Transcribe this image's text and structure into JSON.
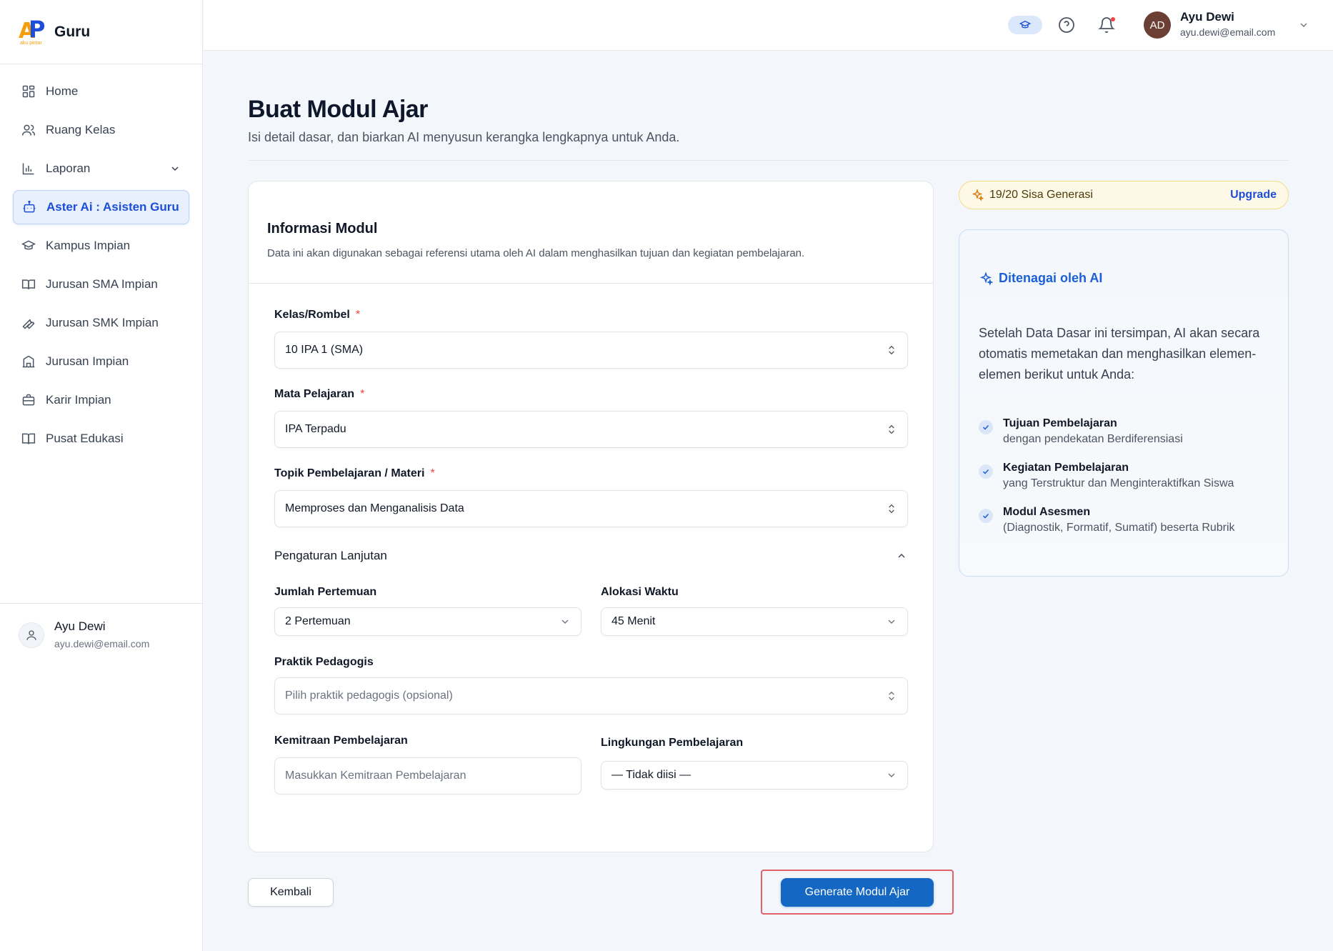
{
  "brand": {
    "logo_text": "AP",
    "logo_sub": "aku pintar",
    "name": "Guru"
  },
  "sidebar": {
    "items": [
      {
        "label": "Home",
        "icon": "grid-icon"
      },
      {
        "label": "Ruang Kelas",
        "icon": "users-icon"
      },
      {
        "label": "Laporan",
        "icon": "bar-chart-icon"
      },
      {
        "label": "Aster Ai : Asisten Guru",
        "icon": "bot-icon"
      },
      {
        "label": "Kampus Impian",
        "icon": "graduation-cap-icon"
      },
      {
        "label": "Jurusan SMA Impian",
        "icon": "book-icon"
      },
      {
        "label": "Jurusan SMK Impian",
        "icon": "wrench-icon"
      },
      {
        "label": "Jurusan Impian",
        "icon": "building-icon"
      },
      {
        "label": "Karir Impian",
        "icon": "briefcase-icon"
      },
      {
        "label": "Pusat Edukasi",
        "icon": "book-open-icon"
      }
    ],
    "active_index": 3,
    "user": {
      "name": "Ayu Dewi",
      "email": "ayu.dewi@email.com"
    }
  },
  "topbar": {
    "user": {
      "initials": "AD",
      "name": "Ayu Dewi",
      "email": "ayu.dewi@email.com"
    },
    "notification_dot": true
  },
  "page": {
    "title": "Buat Modul Ajar",
    "subtitle": "Isi detail dasar, dan biarkan AI menyusun kerangka lengkapnya untuk Anda."
  },
  "form": {
    "title": "Informasi Modul",
    "description": "Data ini akan digunakan sebagai referensi utama oleh AI dalam menghasilkan tujuan dan kegiatan pembelajaran.",
    "required_mark": "*",
    "kelas": {
      "label": "Kelas/Rombel",
      "value": "10 IPA 1 (SMA)"
    },
    "mapel": {
      "label": "Mata Pelajaran",
      "value": "IPA Terpadu"
    },
    "topik": {
      "label": "Topik Pembelajaran / Materi",
      "value": "Memproses dan Menganalisis Data"
    },
    "advanced": {
      "label": "Pengaturan Lanjutan",
      "expanded": true
    },
    "pertemuan": {
      "label": "Jumlah Pertemuan",
      "value": "2 Pertemuan"
    },
    "alokasi": {
      "label": "Alokasi Waktu",
      "value": "45 Menit"
    },
    "pedagogis": {
      "label": "Praktik Pedagogis",
      "placeholder": "Pilih praktik pedagogis (opsional)"
    },
    "kemitraan": {
      "label": "Kemitraan Pembelajaran",
      "placeholder": "Masukkan Kemitraan Pembelajaran"
    },
    "lingkungan": {
      "label": "Lingkungan Pembelajaran",
      "value": "— Tidak diisi —"
    }
  },
  "quota": {
    "text": "19/20 Sisa Generasi",
    "upgrade_label": "Upgrade"
  },
  "ai_panel": {
    "title": "Ditenagai oleh AI",
    "description": "Setelah Data Dasar ini tersimpan, AI akan secara otomatis memetakan dan menghasilkan elemen-elemen berikut untuk Anda:",
    "items": [
      {
        "title": "Tujuan Pembelajaran",
        "subtitle": "dengan pendekatan Berdiferensiasi"
      },
      {
        "title": "Kegiatan Pembelajaran",
        "subtitle": "yang Terstruktur dan Menginteraktifkan Siswa"
      },
      {
        "title": "Modul Asesmen",
        "subtitle": "(Diagnostik, Formatif, Sumatif) beserta Rubrik"
      }
    ]
  },
  "actions": {
    "back_label": "Kembali",
    "generate_label": "Generate Modul Ajar"
  },
  "colors": {
    "primary": "#1467c2",
    "accent_blue": "#1d4ed8",
    "required": "#ef4444",
    "highlight_border": "#e0626a"
  }
}
